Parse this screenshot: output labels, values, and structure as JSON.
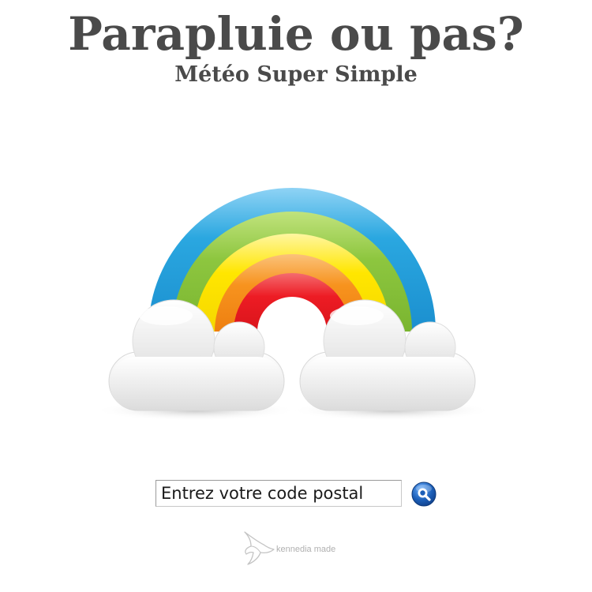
{
  "header": {
    "title": "Parapluie ou pas?",
    "subtitle": "Météo Super Simple"
  },
  "search": {
    "placeholder": "Entrez votre code postal",
    "button_icon": "magnifier-icon"
  },
  "footer": {
    "credit": "kennedia made",
    "logo_icon": "bird-icon"
  },
  "colors": {
    "text": "#4a4a4a",
    "rainbow": [
      "#2aa7e0",
      "#8dc63f",
      "#ffe600",
      "#f7931e",
      "#ed1c24"
    ],
    "cloud": "#e6e6e6",
    "button": "#1c5fb8"
  }
}
